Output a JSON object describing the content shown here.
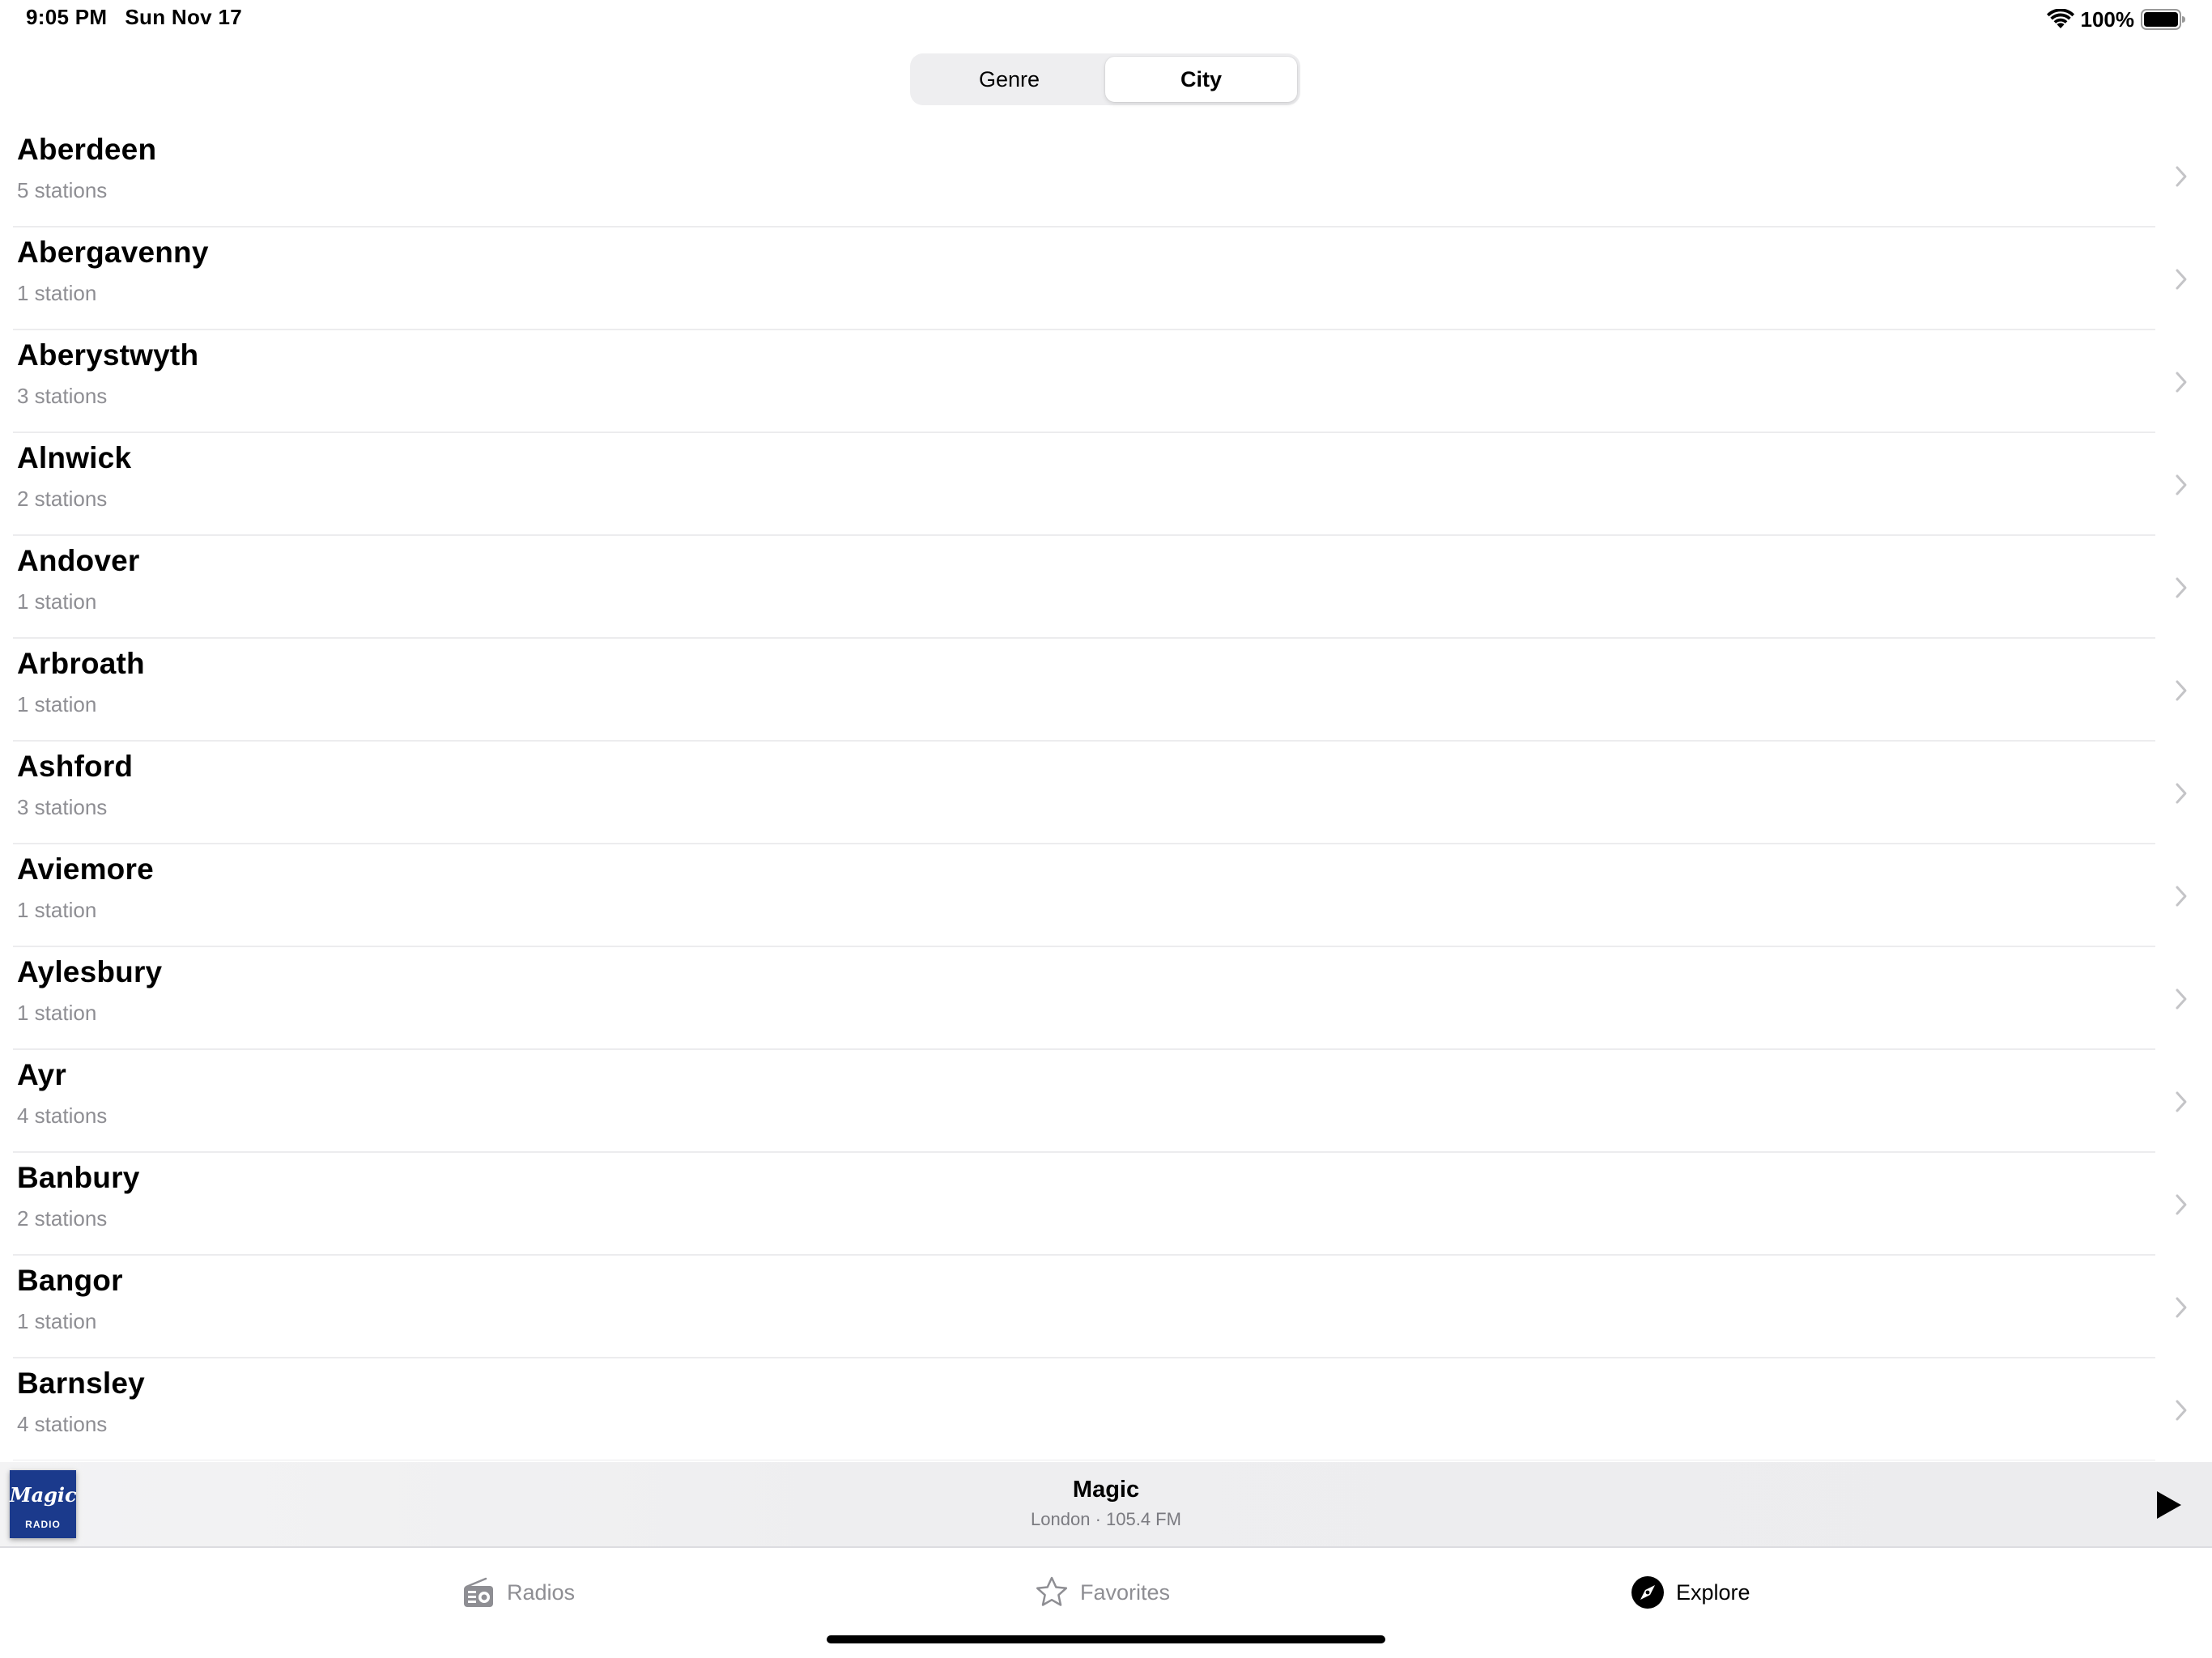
{
  "status_bar": {
    "time": "9:05 PM",
    "date": "Sun Nov 17",
    "battery": "100%"
  },
  "segments": [
    {
      "label": "Genre",
      "selected": false
    },
    {
      "label": "City",
      "selected": true
    }
  ],
  "cities": [
    {
      "name": "Aberdeen",
      "count": "5 stations"
    },
    {
      "name": "Abergavenny",
      "count": "1 station"
    },
    {
      "name": "Aberystwyth",
      "count": "3 stations"
    },
    {
      "name": "Alnwick",
      "count": "2 stations"
    },
    {
      "name": "Andover",
      "count": "1 station"
    },
    {
      "name": "Arbroath",
      "count": "1 station"
    },
    {
      "name": "Ashford",
      "count": "3 stations"
    },
    {
      "name": "Aviemore",
      "count": "1 station"
    },
    {
      "name": "Aylesbury",
      "count": "1 station"
    },
    {
      "name": "Ayr",
      "count": "4 stations"
    },
    {
      "name": "Banbury",
      "count": "2 stations"
    },
    {
      "name": "Bangor",
      "count": "1 station"
    },
    {
      "name": "Barnsley",
      "count": "4 stations"
    }
  ],
  "player": {
    "logo_word": "Magic",
    "logo_sub": "RADIO",
    "title": "Magic",
    "subtitle": "London · 105.4 FM",
    "logo_color": "#1b3a8c"
  },
  "tabs": [
    {
      "label": "Radios",
      "icon": "radio-icon",
      "active": false
    },
    {
      "label": "Favorites",
      "icon": "star-icon",
      "active": false
    },
    {
      "label": "Explore",
      "icon": "compass-icon",
      "active": true
    }
  ]
}
